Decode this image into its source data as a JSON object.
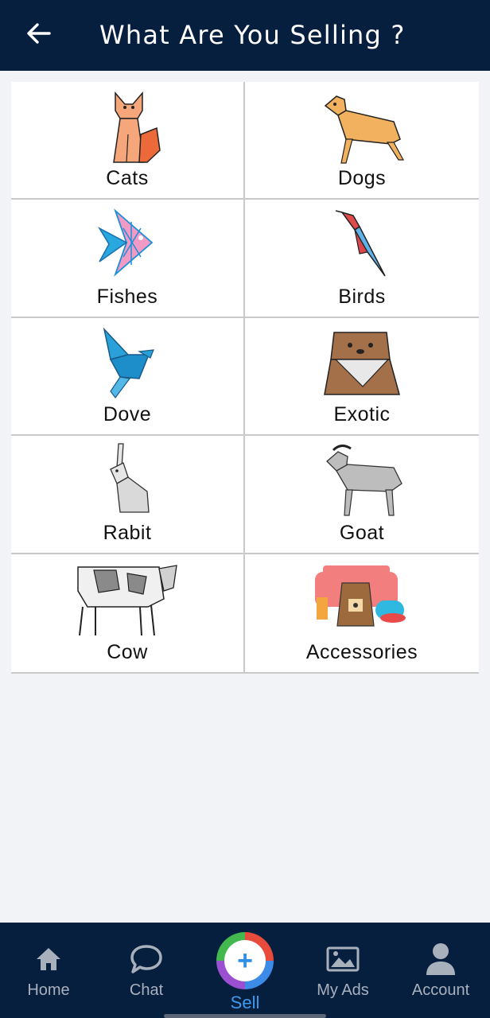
{
  "header": {
    "title": "What Are You Selling ?"
  },
  "categories": [
    {
      "label": "Cats",
      "icon": "cat-icon"
    },
    {
      "label": "Dogs",
      "icon": "dog-icon"
    },
    {
      "label": "Fishes",
      "icon": "fish-icon"
    },
    {
      "label": "Birds",
      "icon": "bird-icon"
    },
    {
      "label": "Dove",
      "icon": "dove-icon"
    },
    {
      "label": "Exotic",
      "icon": "ferret-icon"
    },
    {
      "label": "Rabit",
      "icon": "rabbit-icon"
    },
    {
      "label": "Goat",
      "icon": "goat-icon"
    },
    {
      "label": "Cow",
      "icon": "cow-icon"
    },
    {
      "label": "Accessories",
      "icon": "pet-accessories-icon"
    }
  ],
  "bottom_nav": {
    "home": "Home",
    "chat": "Chat",
    "sell": "Sell",
    "my_ads": "My Ads",
    "account": "Account"
  },
  "colors": {
    "header_bg": "#071f3f",
    "page_bg": "#f1f3f6",
    "sell_label": "#3d9aee",
    "nav_inactive": "#a8b0bc"
  }
}
